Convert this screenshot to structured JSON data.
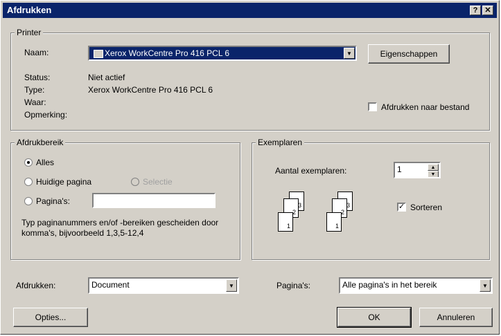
{
  "window": {
    "title": "Afdrukken",
    "help_glyph": "?",
    "close_glyph": "✕"
  },
  "printer": {
    "group_label": "Printer",
    "name_label": "Naam:",
    "name_value": "Xerox WorkCentre Pro 416 PCL 6",
    "properties_button": "Eigenschappen",
    "status_label": "Status:",
    "status_value": "Niet actief",
    "type_label": "Type:",
    "type_value": "Xerox WorkCentre Pro 416 PCL 6",
    "where_label": "Waar:",
    "where_value": "",
    "comment_label": "Opmerking:",
    "comment_value": "",
    "print_to_file_label": "Afdrukken naar bestand",
    "print_to_file_checked": false
  },
  "range": {
    "group_label": "Afdrukbereik",
    "all_label": "Alles",
    "current_page_label": "Huidige pagina",
    "selection_label": "Selectie",
    "pages_label": "Pagina's:",
    "pages_value": "",
    "hint": "Typ paginanummers en/of -bereiken gescheiden door komma's, bijvoorbeeld 1,3,5-12,4",
    "selected": "all"
  },
  "copies": {
    "group_label": "Exemplaren",
    "count_label": "Aantal exemplaren:",
    "count_value": "1",
    "collate_label": "Sorteren",
    "collate_checked": true,
    "page_numbers": [
      "1",
      "2",
      "3"
    ]
  },
  "bottom": {
    "print_what_label": "Afdrukken:",
    "print_what_value": "Document",
    "pages_label": "Pagina's:",
    "pages_value": "Alle pagina's in het bereik",
    "options_button": "Opties...",
    "ok_button": "OK",
    "cancel_button": "Annuleren"
  }
}
